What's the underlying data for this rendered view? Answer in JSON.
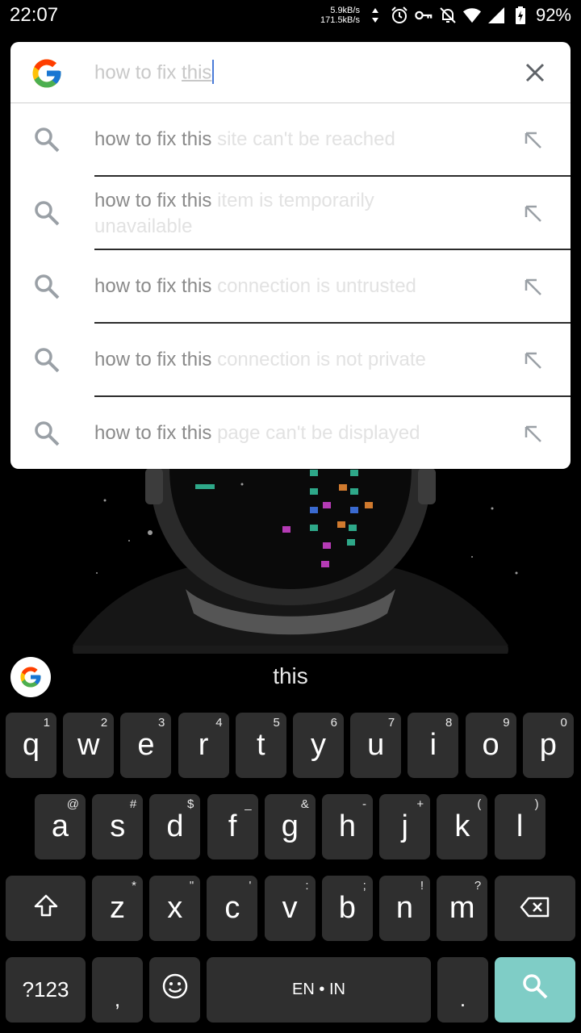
{
  "status_bar": {
    "time": "22:07",
    "net_up": "5.9kB/s",
    "net_down": "171.5kB/s",
    "battery": "92%",
    "icons": [
      "data-arrows-icon",
      "alarm-icon",
      "vpn-key-icon",
      "notifications-off-icon",
      "wifi-icon",
      "signal-icon",
      "battery-charging-icon"
    ]
  },
  "search": {
    "query_typed": "how to fix ",
    "query_selected": "this",
    "clear_icon": "close-icon",
    "suggestions": [
      {
        "prefix": "how to fix this ",
        "completion": "site can't be reached"
      },
      {
        "prefix": "how to fix this ",
        "completion": "item is temporarily unavailable"
      },
      {
        "prefix": "how to fix this ",
        "completion": "connection is untrusted"
      },
      {
        "prefix": "how to fix this ",
        "completion": "connection is not private"
      },
      {
        "prefix": "how to fix this ",
        "completion": "page can't be displayed"
      }
    ]
  },
  "keyboard": {
    "suggestion_word": "this",
    "row1": [
      {
        "label": "q",
        "hint": "1"
      },
      {
        "label": "w",
        "hint": "2"
      },
      {
        "label": "e",
        "hint": "3"
      },
      {
        "label": "r",
        "hint": "4"
      },
      {
        "label": "t",
        "hint": "5"
      },
      {
        "label": "y",
        "hint": "6"
      },
      {
        "label": "u",
        "hint": "7"
      },
      {
        "label": "i",
        "hint": "8"
      },
      {
        "label": "o",
        "hint": "9"
      },
      {
        "label": "p",
        "hint": "0"
      }
    ],
    "row2": [
      {
        "label": "a",
        "hint": "@"
      },
      {
        "label": "s",
        "hint": "#"
      },
      {
        "label": "d",
        "hint": "$"
      },
      {
        "label": "f",
        "hint": "_"
      },
      {
        "label": "g",
        "hint": "&"
      },
      {
        "label": "h",
        "hint": "-"
      },
      {
        "label": "j",
        "hint": "+"
      },
      {
        "label": "k",
        "hint": "("
      },
      {
        "label": "l",
        "hint": ")"
      }
    ],
    "row3": [
      {
        "label": "z",
        "hint": "*"
      },
      {
        "label": "x",
        "hint": "\""
      },
      {
        "label": "c",
        "hint": "'"
      },
      {
        "label": "v",
        "hint": ":"
      },
      {
        "label": "b",
        "hint": ";"
      },
      {
        "label": "n",
        "hint": "!"
      },
      {
        "label": "m",
        "hint": "?"
      }
    ],
    "symbols_label": "?123",
    "comma_label": ",",
    "space_label": "EN • IN",
    "period_label": ".",
    "accent_color": "#7fcdc6"
  }
}
